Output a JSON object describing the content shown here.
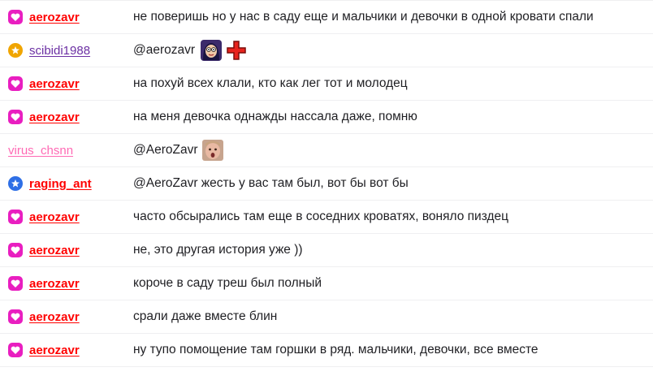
{
  "colors": {
    "aerozavr": "#ff0000",
    "scibidi1988": "#6b2fa3",
    "virus_chsnn": "#ff69b4",
    "raging_ant": "#ff0000",
    "badge_heart": "#e91ec0",
    "badge_star": "#f0a500",
    "badge_blue": "#2e6fe6"
  },
  "messages": [
    {
      "badge": "heart-badge",
      "user": "aerozavr",
      "text": "не поверишь но у нас в саду еще и мальчики и девочки в одной кровати спали"
    },
    {
      "badge": "star-badge",
      "user": "scibidi1988",
      "text": "@aerozavr",
      "emotes": [
        "face-emote",
        "red-cross-emote"
      ]
    },
    {
      "badge": "heart-badge",
      "user": "aerozavr",
      "text": "на похуй всех клали, кто как лег тот и молодец"
    },
    {
      "badge": "heart-badge",
      "user": "aerozavr",
      "text": "на меня девочка однажды нассала даже, помню"
    },
    {
      "badge": "",
      "user": "virus_chsnn",
      "text": "@AeroZavr",
      "emotes": [
        "surprised-face-emote"
      ]
    },
    {
      "badge": "star-blue-badge",
      "user": "raging_ant",
      "text": "@AeroZavr жесть у вас там был, вот бы вот бы"
    },
    {
      "badge": "heart-badge",
      "user": "aerozavr",
      "text": "часто обсырались там еще в соседних кроватях, воняло пиздец"
    },
    {
      "badge": "heart-badge",
      "user": "aerozavr",
      "text": "не, это другая история уже ))"
    },
    {
      "badge": "heart-badge",
      "user": "aerozavr",
      "text": "короче в саду треш был полный"
    },
    {
      "badge": "heart-badge",
      "user": "aerozavr",
      "text": "срали даже вместе блин"
    },
    {
      "badge": "heart-badge",
      "user": "aerozavr",
      "text": "ну тупо помощение там горшки в ряд. мальчики, девочки, все вместе"
    }
  ]
}
